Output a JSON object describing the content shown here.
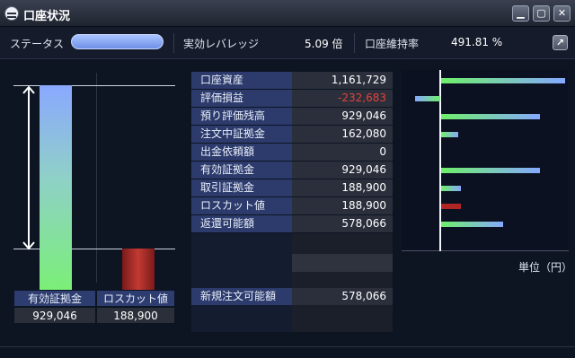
{
  "window": {
    "title": "口座状況",
    "buttons": [
      "minimize-icon",
      "maximize-icon",
      "close-icon"
    ]
  },
  "statusbar": {
    "status_label": "ステータス",
    "leverage_label": "実効レバレッジ",
    "leverage_value": "5.09 倍",
    "maintenance_label": "口座維持率",
    "maintenance_value": "491.81 %",
    "external_icon": "open-external-icon"
  },
  "left_chart": {
    "green_label": "有効証拠金",
    "green_value": "929,046",
    "red_label": "ロスカット値",
    "red_value": "188,900",
    "arrow_icon": "double-arrow-icon"
  },
  "table": {
    "rows": [
      {
        "label": "口座資産",
        "value": "1,161,729"
      },
      {
        "label": "評価損益",
        "value": "-232,683"
      },
      {
        "label": "預り評価残高",
        "value": "929,046"
      },
      {
        "label": "注文中証拠金",
        "value": "162,080"
      },
      {
        "label": "出金依頼額",
        "value": "0"
      },
      {
        "label": "有効証拠金",
        "value": "929,046"
      },
      {
        "label": "取引証拠金",
        "value": "188,900"
      },
      {
        "label": "ロスカット値",
        "value": "188,900"
      },
      {
        "label": "返還可能額",
        "value": "578,066"
      }
    ],
    "new_order_label": "新規注文可能額",
    "new_order_value": "578,066"
  },
  "right_chart": {
    "unit_label": "単位（円）",
    "colors": {
      "positive": "#6ff06a",
      "mid": "#86a8ff",
      "loss_cut": "#b02626"
    }
  },
  "chart_data": {
    "type": "bar",
    "orientation": "horizontal",
    "categories": [
      "口座資産",
      "評価損益",
      "預り評価残高",
      "注文中証拠金",
      "出金依頼額",
      "有効証拠金",
      "取引証拠金",
      "ロスカット値",
      "返還可能額"
    ],
    "values": [
      1161729,
      -232683,
      929046,
      162080,
      0,
      929046,
      188900,
      188900,
      578066
    ],
    "title": "",
    "xlabel": "",
    "ylabel": "",
    "grid": false
  }
}
